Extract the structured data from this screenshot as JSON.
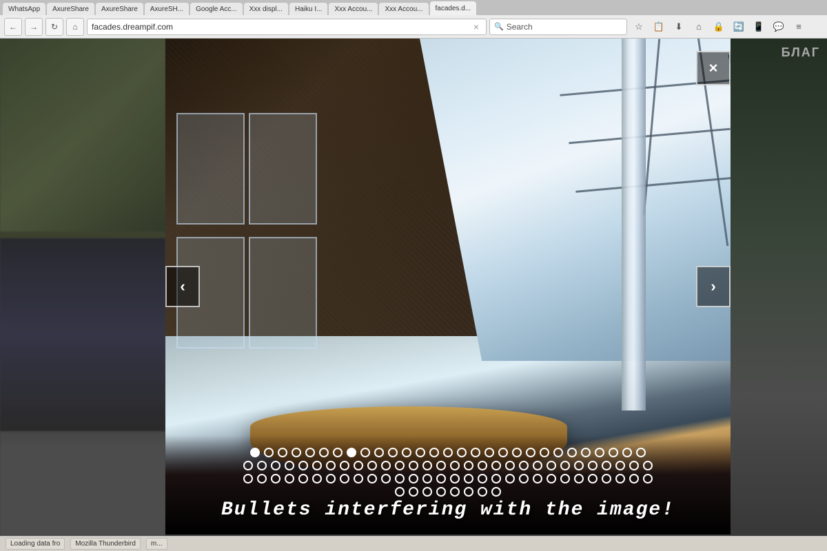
{
  "browser": {
    "address": "facades.dreampif.com",
    "address_close": "×",
    "search_placeholder": "Search",
    "tabs": [
      {
        "label": "WhatsApp",
        "active": false
      },
      {
        "label": "AxureShare",
        "active": false
      },
      {
        "label": "AxureShare",
        "active": false
      },
      {
        "label": "AxureSH...",
        "active": false
      },
      {
        "label": "Google Acc...",
        "active": false
      },
      {
        "label": "Xxx displ...",
        "active": false
      },
      {
        "label": "Haiku I...",
        "active": false
      },
      {
        "label": "Xxx Accou...",
        "active": false
      },
      {
        "label": "Xxx Accou...",
        "active": false
      },
      {
        "label": "facades.d...",
        "active": true
      }
    ],
    "nav_buttons": [
      "←",
      "→",
      "↻",
      "🏠"
    ],
    "icons": [
      "★",
      "📋",
      "⬇",
      "🏠",
      "🔒",
      "🔄",
      "📱",
      "≡"
    ]
  },
  "top_right": {
    "text": "БЛАГ"
  },
  "lightbox": {
    "close_label": "×",
    "prev_label": "‹",
    "next_label": "›",
    "watermark": "Bullets interfering with the image!",
    "bullets": {
      "rows": [
        {
          "count": 29,
          "active_index": 7
        },
        {
          "count": 30,
          "active_index": -1
        },
        {
          "count": 30,
          "active_index": -1
        },
        {
          "count": 8,
          "active_index": -1
        }
      ]
    }
  },
  "status_bar": {
    "items": [
      {
        "label": "Loading data fro"
      },
      {
        "label": "Mozilla Thunderbird"
      },
      {
        "label": "m..."
      }
    ]
  }
}
